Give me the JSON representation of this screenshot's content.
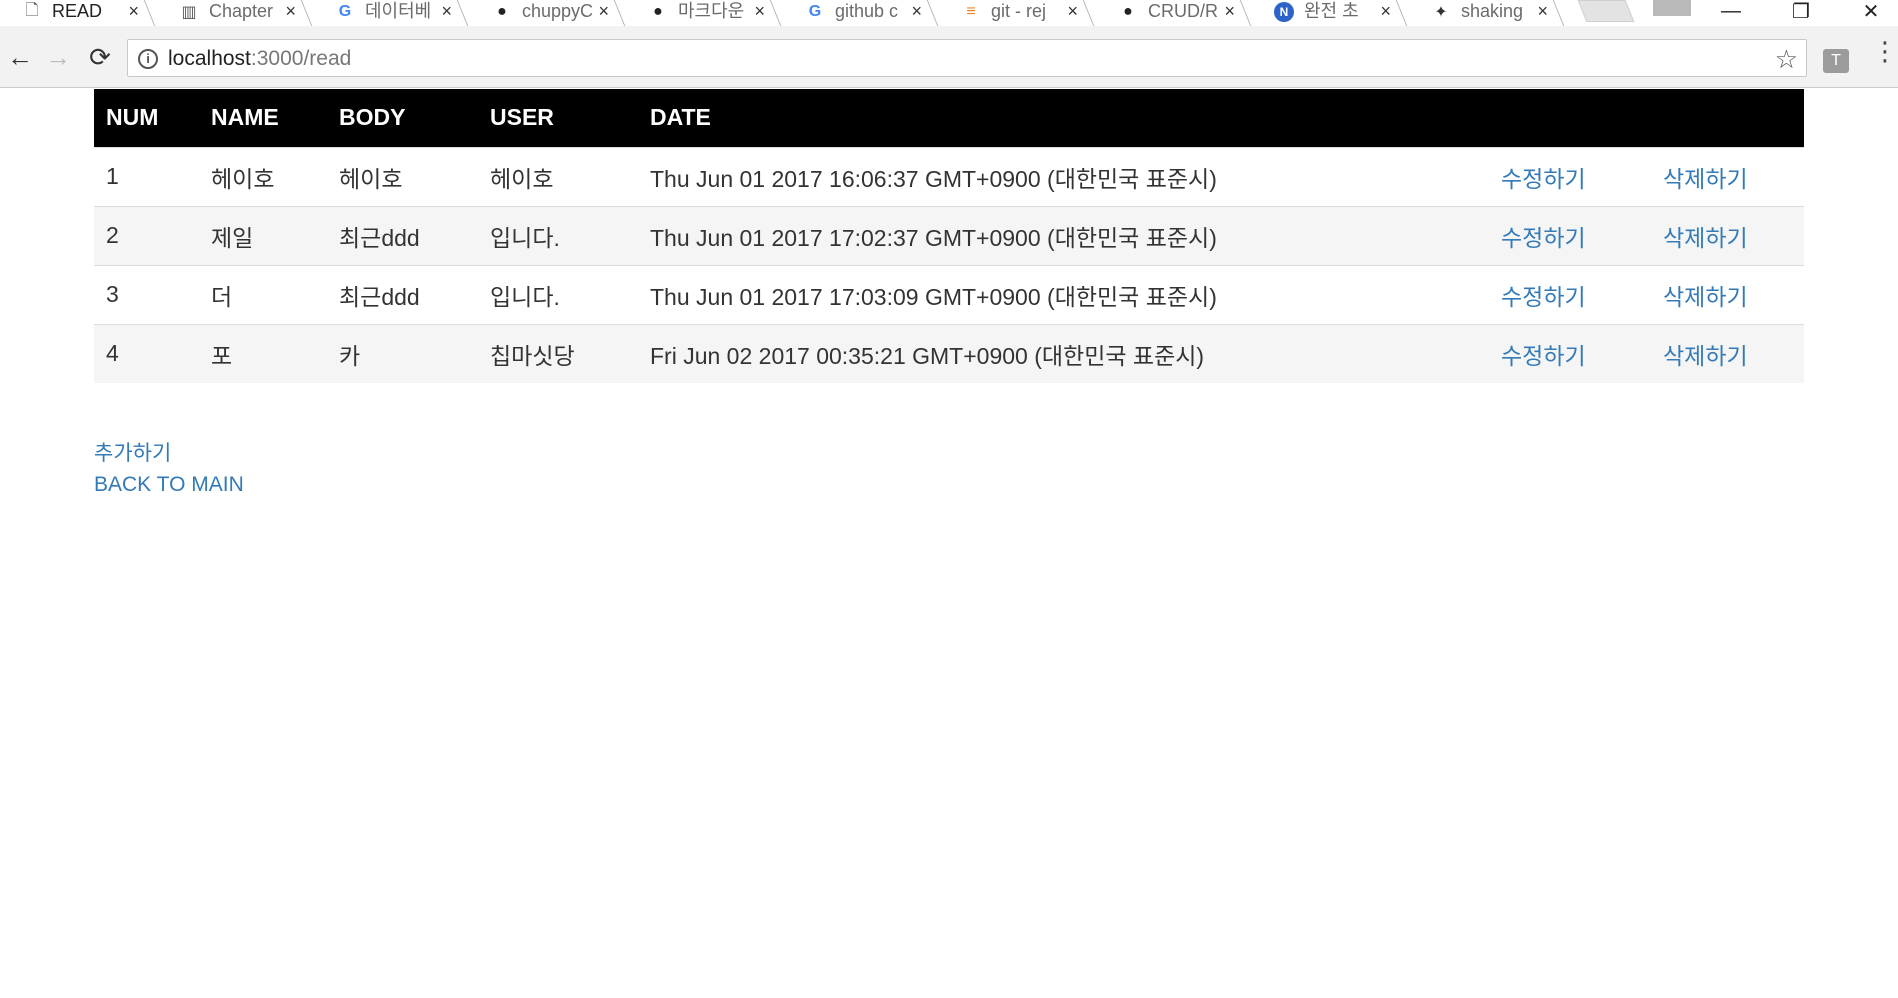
{
  "browser": {
    "tabs": [
      {
        "title": "READ",
        "icon": "page-icon",
        "active": true
      },
      {
        "title": "Chapter",
        "icon": "db-icon"
      },
      {
        "title": "데이터베",
        "icon": "google-icon"
      },
      {
        "title": "chuppyC",
        "icon": "github-icon"
      },
      {
        "title": "마크다운",
        "icon": "github-icon"
      },
      {
        "title": "github c",
        "icon": "google-icon"
      },
      {
        "title": "git - rej",
        "icon": "stackoverflow-icon"
      },
      {
        "title": "CRUD/R",
        "icon": "github-icon"
      },
      {
        "title": "완전 초",
        "icon": "n-icon"
      },
      {
        "title": "shaking",
        "icon": "shaking-icon"
      }
    ],
    "close_glyph": "×",
    "url": {
      "host": "localhost",
      "path": ":3000/read"
    },
    "ext_label": "T"
  },
  "table": {
    "headers": {
      "num": "NUM",
      "name": "NAME",
      "body": "BODY",
      "user": "USER",
      "date": "DATE"
    },
    "rows": [
      {
        "num": "1",
        "name": "헤이호",
        "body": "헤이호",
        "user": "헤이호",
        "date": "Thu Jun 01 2017 16:06:37 GMT+0900 (대한민국 표준시)",
        "edit": "수정하기",
        "delete": "삭제하기"
      },
      {
        "num": "2",
        "name": "제일",
        "body": "최근ddd",
        "user": "입니다.",
        "date": "Thu Jun 01 2017 17:02:37 GMT+0900 (대한민국 표준시)",
        "edit": "수정하기",
        "delete": "삭제하기"
      },
      {
        "num": "3",
        "name": "더",
        "body": "최근ddd",
        "user": "입니다.",
        "date": "Thu Jun 01 2017 17:03:09 GMT+0900 (대한민국 표준시)",
        "edit": "수정하기",
        "delete": "삭제하기"
      },
      {
        "num": "4",
        "name": "포",
        "body": "카",
        "user": "칩마싯당",
        "date": "Fri Jun 02 2017 00:35:21 GMT+0900 (대한민국 표준시)",
        "edit": "수정하기",
        "delete": "삭제하기"
      }
    ]
  },
  "links": {
    "add": "추가하기",
    "back": "BACK TO MAIN"
  },
  "colors": {
    "header_bg": "#000000",
    "link": "#337ab7",
    "row_stripe": "#f5f5f5"
  }
}
